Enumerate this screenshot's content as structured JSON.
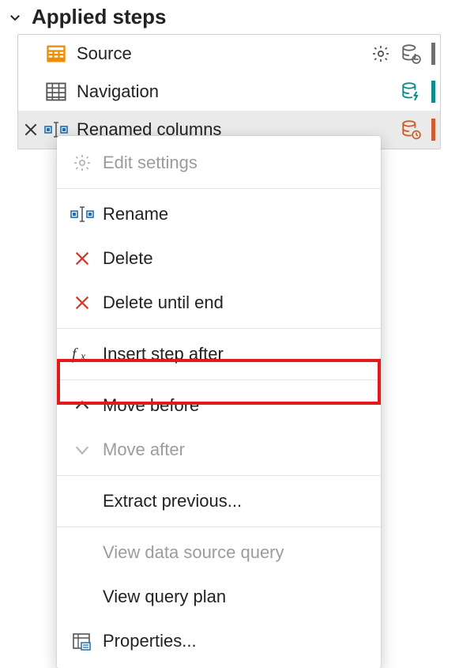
{
  "pane": {
    "title": "Applied steps"
  },
  "steps": [
    {
      "label": "Source"
    },
    {
      "label": "Navigation"
    },
    {
      "label": "Renamed columns"
    }
  ],
  "accent_colors": {
    "source": "#707070",
    "navigation": "#0a8d8d",
    "renamed": "#d15b2c"
  },
  "context_menu": {
    "edit_settings": "Edit settings",
    "rename": "Rename",
    "delete": "Delete",
    "delete_until_end": "Delete until end",
    "insert_step_after": "Insert step after",
    "move_before": "Move before",
    "move_after": "Move after",
    "extract_previous": "Extract previous...",
    "view_data_source_query": "View data source query",
    "view_query_plan": "View query plan",
    "properties": "Properties..."
  }
}
